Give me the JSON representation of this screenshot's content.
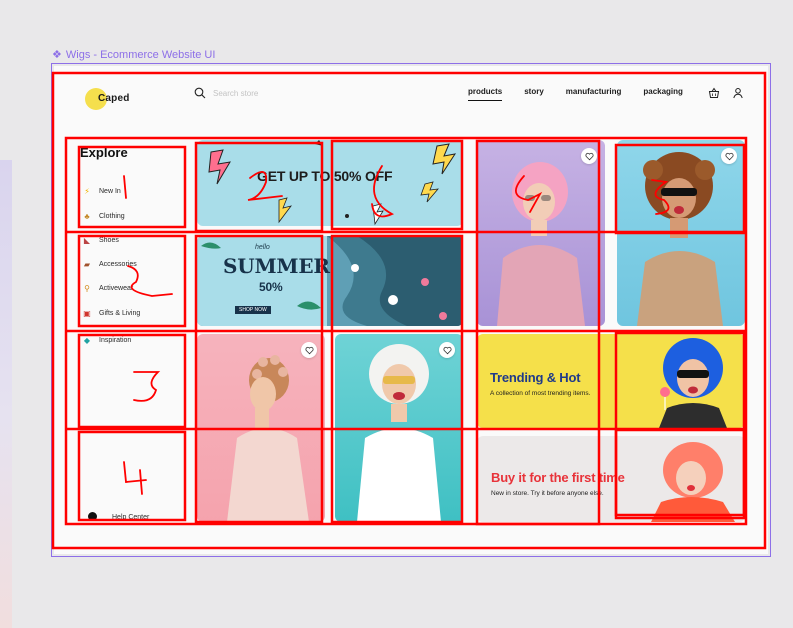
{
  "frame": {
    "label": "Wigs - Ecommerce Website UI"
  },
  "header": {
    "logo_text": "Caped",
    "search_placeholder": "Search store",
    "nav": [
      {
        "label": "products",
        "active": true
      },
      {
        "label": "story",
        "active": false
      },
      {
        "label": "manufacturing",
        "active": false
      },
      {
        "label": "packaging",
        "active": false
      }
    ],
    "icons": [
      "basket-icon",
      "user-icon"
    ]
  },
  "sidebar": {
    "title": "Explore",
    "items": [
      {
        "label": "New In",
        "icon": "lightning-icon"
      },
      {
        "label": "Clothing",
        "icon": "dress-icon"
      },
      {
        "label": "Shoes",
        "icon": "shoe-icon"
      },
      {
        "label": "Accessories",
        "icon": "bag-icon"
      },
      {
        "label": "Activewear",
        "icon": "runner-icon"
      },
      {
        "label": "Gifts & Living",
        "icon": "gift-icon"
      },
      {
        "label": "Inspiration",
        "icon": "diamond-icon"
      }
    ],
    "help_label": "Help Center"
  },
  "promos": {
    "sale_banner": "GET UP TO 50% OFF",
    "summer": {
      "script": "hello",
      "title": "SUMMER",
      "percent": "50%",
      "tagline": "SHOP NOW"
    },
    "trending": {
      "title": "Trending & Hot",
      "subtitle": "A collection of most trending items."
    },
    "first_time": {
      "title": "Buy it for the first time",
      "subtitle": "New in store. Try it before anyone else."
    }
  },
  "colors": {
    "accent_yellow": "#f5df4d",
    "frame_purple": "#8d6fe8",
    "annotation_red": "#ff0000",
    "trending_title": "#1f3a8a",
    "first_time_title": "#e8333a"
  },
  "annotations": [
    "1",
    "2",
    "3",
    "4"
  ]
}
